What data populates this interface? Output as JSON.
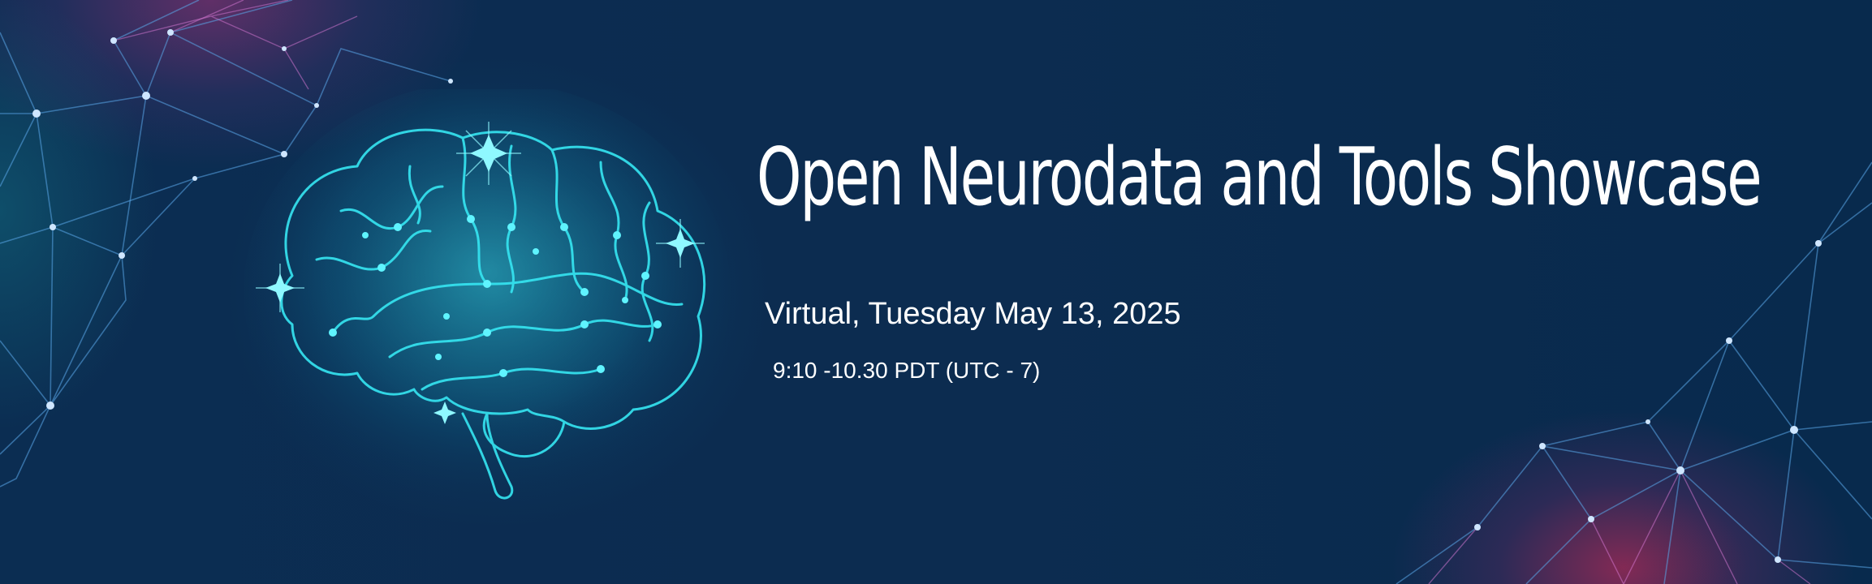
{
  "event": {
    "title": "Open Neurodata and Tools Showcase",
    "date_line": "Virtual, Tuesday May 13, 2025",
    "time_line": "9:10 -10.30 PDT (UTC - 7)"
  },
  "icons": {
    "brain": "glowing-brain-icon",
    "network": "network-pattern"
  },
  "colors": {
    "background": "#0b2a4e",
    "brain_glow": "#2fe3f0",
    "text": "#ffffff",
    "accent_pink": "#e8336a"
  }
}
